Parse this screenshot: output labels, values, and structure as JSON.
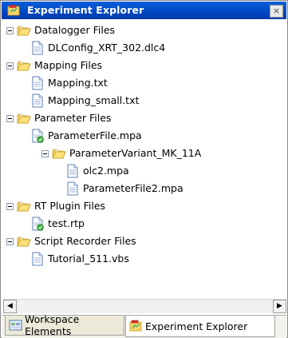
{
  "window": {
    "title": "Experiment Explorer",
    "close_glyph": "×"
  },
  "tree": {
    "datalogger": {
      "label": "Datalogger Files",
      "children": [
        "DLConfig_XRT_302.dlc4"
      ]
    },
    "mapping": {
      "label": "Mapping Files",
      "children": [
        "Mapping.txt",
        "Mapping_small.txt"
      ]
    },
    "parameter": {
      "label": "Parameter Files",
      "file": "ParameterFile.mpa",
      "variant": {
        "label": "ParameterVariant_MK_11A",
        "children": [
          "olc2.mpa",
          "ParameterFile2.mpa"
        ]
      }
    },
    "rtplugin": {
      "label": "RT Plugin Files",
      "children": [
        "test.rtp"
      ]
    },
    "script": {
      "label": "Script Recorder Files",
      "children": [
        "Tutorial_511.vbs"
      ]
    }
  },
  "scrollbar": {
    "left_glyph": "◀",
    "right_glyph": "▶"
  },
  "tabs": [
    {
      "label": "Workspace Elements",
      "icon": "workspace-icon",
      "active": false
    },
    {
      "label": "Experiment Explorer",
      "icon": "experiment-explorer-icon",
      "active": true
    }
  ],
  "colors": {
    "title_bar": "#0052cc",
    "folder": "#f2c94c",
    "selection_tab": "#ffffff"
  }
}
